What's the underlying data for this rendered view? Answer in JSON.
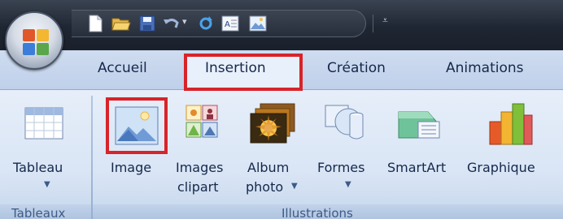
{
  "tabs": {
    "home": "Accueil",
    "insert": "Insertion",
    "design": "Création",
    "animations": "Animations"
  },
  "groups": {
    "tables": "Tableaux",
    "illustrations": "Illustrations"
  },
  "buttons": {
    "table": "Tableau",
    "image": "Image",
    "clipart_line1": "Images",
    "clipart_line2": "clipart",
    "album_line1": "Album",
    "album_line2": "photo",
    "shapes": "Formes",
    "smartart": "SmartArt",
    "chart": "Graphique"
  },
  "icons": {
    "office_button": "office-logo-icon",
    "qat": [
      "new-document-icon",
      "open-folder-icon",
      "save-icon",
      "undo-icon",
      "redo-icon",
      "text-box-icon",
      "picture-icon",
      "customize-qat-icon"
    ]
  },
  "colors": {
    "highlight": "#d8232a",
    "text": "#15284b"
  }
}
